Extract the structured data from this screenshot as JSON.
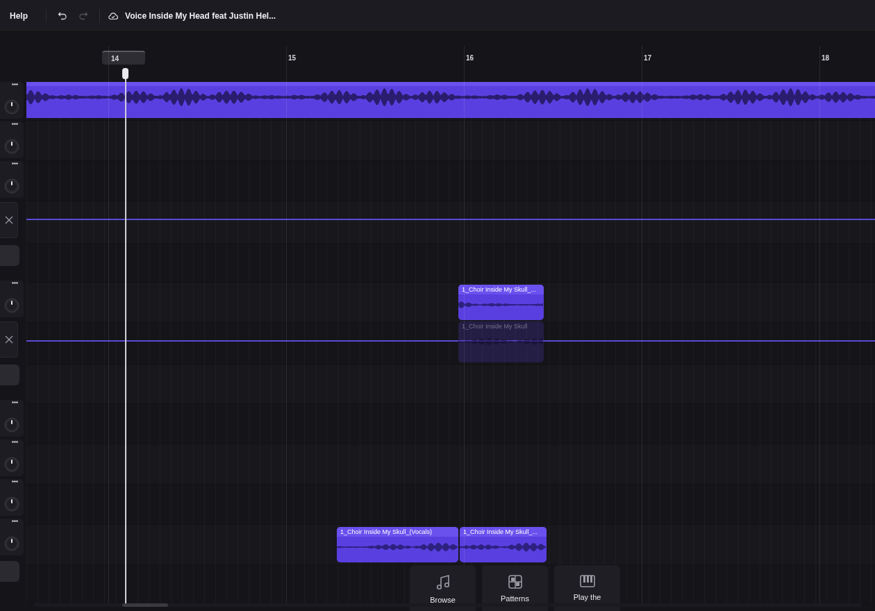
{
  "toolbar": {
    "help": "Help",
    "undo_enabled": true,
    "redo_enabled": false,
    "title": "Voice Inside My Head feat Justin Hel..."
  },
  "ruler": {
    "bars": [
      {
        "label": "14",
        "selected": true
      },
      {
        "label": "15",
        "selected": false
      },
      {
        "label": "16",
        "selected": false
      },
      {
        "label": "17",
        "selected": false
      },
      {
        "label": "18",
        "selected": false
      }
    ]
  },
  "tracks": [
    {
      "kind": "audio",
      "clips": [
        {
          "kind": "full"
        }
      ]
    },
    {
      "kind": "audio"
    },
    {
      "kind": "audio"
    },
    {
      "kind": "automation"
    },
    {
      "kind": "empty"
    },
    {
      "kind": "audio",
      "clips": [
        {
          "kind": "normal",
          "name": "1_Choir Inside My Skull_..."
        }
      ]
    },
    {
      "kind": "automation",
      "clips": [
        {
          "kind": "ghost",
          "name": "1_Choir Inside My Skull"
        }
      ]
    },
    {
      "kind": "empty"
    },
    {
      "kind": "audio"
    },
    {
      "kind": "audio"
    },
    {
      "kind": "audio"
    },
    {
      "kind": "audio",
      "clips": [
        {
          "kind": "normal",
          "name": "1_Choir Inside My Skull_(Vocals)"
        },
        {
          "kind": "normal",
          "name": "1_Choir Inside My Skull_..."
        }
      ]
    },
    {
      "kind": "empty"
    }
  ],
  "shortcuts": [
    {
      "kind": "browse",
      "label": "Browse"
    },
    {
      "kind": "patterns",
      "label": "Patterns"
    },
    {
      "kind": "keys",
      "label": "Play the"
    }
  ]
}
